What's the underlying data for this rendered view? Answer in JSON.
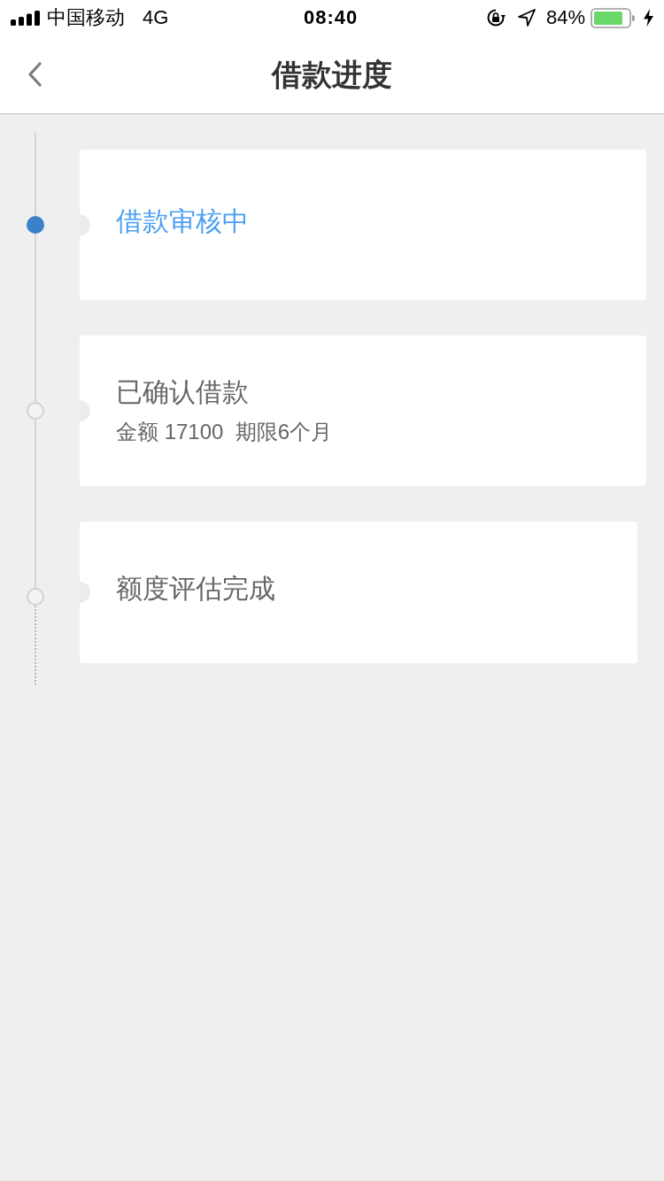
{
  "status_bar": {
    "carrier": "中国移动",
    "network": "4G",
    "time": "08:40",
    "battery_percent": "84%",
    "charging": true
  },
  "nav_bar": {
    "title": "借款进度"
  },
  "steps": [
    {
      "title": "借款审核中",
      "current": true
    },
    {
      "title": "已确认借款",
      "detail": "金额 17100  期限6个月",
      "current": false
    },
    {
      "title": "额度评估完成",
      "current": false
    }
  ]
}
